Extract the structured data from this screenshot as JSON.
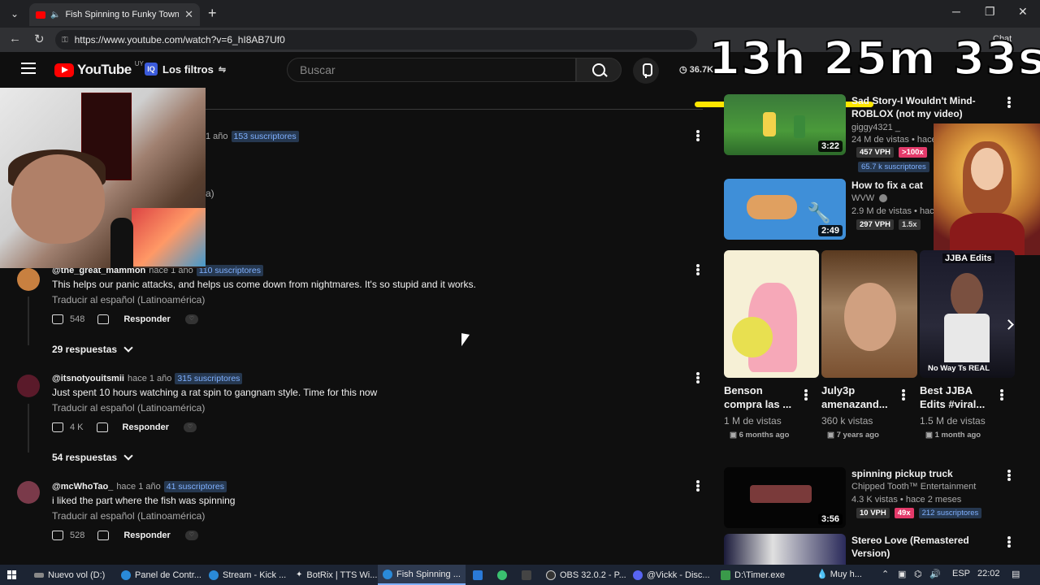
{
  "browser": {
    "tab_title": "Fish Spinning to Funky Town",
    "tab_close": "✕",
    "new_tab": "+",
    "url": "https://www.youtube.com/watch?v=6_hI8AB7Uf0",
    "chat_label": "Chat",
    "window_controls": [
      "─",
      "❐",
      "✕"
    ]
  },
  "header": {
    "logo_text": "YouTube",
    "country_code": "UY",
    "filters_label": "Los filtros",
    "filters_icon": "IQ",
    "search_placeholder": "Buscar",
    "views_badge": "36.7K"
  },
  "overlay": {
    "timer": "13h 25m 33s"
  },
  "comments": [
    {
      "meta_age": "1 año",
      "subs": "153 suscriptores",
      "partial": "a)"
    },
    {
      "handle": "@the_great_mammon",
      "age": "hace 1 año",
      "subs": "110 suscriptores",
      "text": "This helps our panic attacks, and helps us come down from nightmares. It's so stupid and it works.",
      "translate": "Traducir al español (Latinoamérica)",
      "likes": "548",
      "reply": "Responder",
      "replies": "29 respuestas",
      "avatar_color": "#c88040"
    },
    {
      "handle": "@itsnotyouitsmii",
      "age": "hace 1 año",
      "subs": "315 suscriptores",
      "text": "Just spent 10 hours watching a rat spin to gangnam style. Time for this now",
      "translate": "Traducir al español (Latinoamérica)",
      "likes": "4 K",
      "reply": "Responder",
      "replies": "54 respuestas",
      "avatar_color": "#5a1a2a"
    },
    {
      "handle": "@mcWhoTao_",
      "age": "hace 1 año",
      "subs": "41 suscriptores",
      "text": "i liked the part where the fish was spinning",
      "translate": "Traducir al español (Latinoamérica)",
      "likes": "528",
      "reply": "Responder",
      "avatar_color": "#7a3a4a"
    }
  ],
  "sidebar": {
    "videos": [
      {
        "title": "Sad Story-I Wouldn't Mind- ROBLOX (not my video)",
        "channel": "giggy4321 _",
        "views": "24 M de vistas • hace",
        "duration": "3:22",
        "vph": "457 VPH",
        "mult": ">100x",
        "subs": "65.7 k suscriptores"
      },
      {
        "title": "How to fix a cat",
        "channel": "WVW",
        "views": "2.9 M de vistas • hac",
        "duration": "2:49",
        "vph": "297 VPH",
        "mult": "1.5x"
      },
      {
        "title": "spinning pickup truck",
        "channel": "Chipped Tooth™ Entertainment",
        "views": "4.3 K vistas • hace 2 meses",
        "duration": "3:56",
        "vph": "10 VPH",
        "mult": "49x",
        "subs": "212 suscriptores"
      },
      {
        "title": "Stereo Love (Remastered Version)"
      }
    ],
    "shorts": [
      {
        "title": "Benson compra las ...",
        "views": "1 M de vistas",
        "age": "6 months ago"
      },
      {
        "title": "July3p amenazand...",
        "views": "360 k vistas",
        "age": "7 years ago"
      },
      {
        "title": "Best JJBA Edits #viral...",
        "views": "1.5 M de vistas",
        "age": "1 month ago",
        "overlay_top": "JJBA Edits",
        "overlay_bottom": "No Way Ts REAL"
      }
    ]
  },
  "taskbar": {
    "items": [
      "Nuevo vol (D:)",
      "Panel de Contr...",
      "Stream - Kick ...",
      "BotRix | TTS Wi...",
      "Fish Spinning ...",
      "OBS 32.0.2 - P...",
      "@Vickk - Disc...",
      "D:\\Timer.exe"
    ],
    "weather": "Muy h...",
    "lang": "ESP",
    "time": "22:02"
  }
}
